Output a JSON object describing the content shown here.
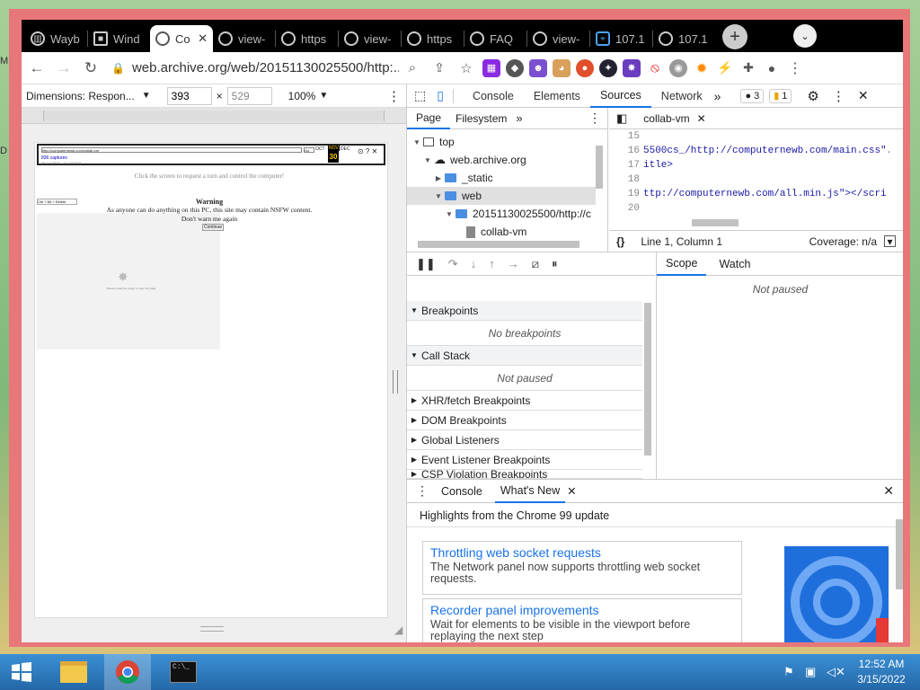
{
  "browser": {
    "tabs": [
      {
        "label": "Wayb",
        "icon": "archive-icon"
      },
      {
        "label": "Wind",
        "icon": "windows-icon"
      },
      {
        "label": "Co",
        "icon": "globe-icon",
        "active": true
      },
      {
        "label": "view-",
        "icon": "globe-icon"
      },
      {
        "label": "https",
        "icon": "globe-icon"
      },
      {
        "label": "view-",
        "icon": "globe-icon"
      },
      {
        "label": "https",
        "icon": "globe-icon"
      },
      {
        "label": "FAQ",
        "icon": "globe-icon"
      },
      {
        "label": "view-",
        "icon": "globe-icon"
      },
      {
        "label": "107.1",
        "icon": "location-icon"
      },
      {
        "label": "107.1",
        "icon": "globe-icon"
      }
    ],
    "new_tab": "+",
    "url": "web.archive.org/web/20151130025500/http:..."
  },
  "device_toolbar": {
    "dimensions_label": "Dimensions: Respon...",
    "width": "393",
    "times": "×",
    "height": "529",
    "zoom": "100%"
  },
  "page": {
    "url_field": "http://computernewb.com/collab-vm",
    "go": "Go",
    "link": "836 captures",
    "captures": "26 Jul 2015 - 10 Jul 2021",
    "cal_prev": "OCT",
    "cal_cur": "NOV",
    "cal_next": "DEC",
    "cal_day": "30",
    "click_msg": "Click the screen to request a turn and control the computer!",
    "ctrl_btn": "Ctrl + Alt + Delete",
    "warning_title": "Warning",
    "warning_text": "As anyone can do anything on this PC, this site may contain NSFW content.",
    "dont_warn": "Don't warn me again",
    "continue": "Continue",
    "plugin_msg": "Please install the plugin to view this page"
  },
  "devtools": {
    "top_tabs": [
      "Console",
      "Elements",
      "Sources",
      "Network"
    ],
    "selected_tab": "Sources",
    "errors": "3",
    "warnings": "1",
    "nav_tabs": [
      "Page",
      "Filesystem"
    ],
    "tree": [
      {
        "label": "top",
        "depth": 0,
        "kind": "frame"
      },
      {
        "label": "web.archive.org",
        "depth": 1,
        "kind": "cloud"
      },
      {
        "label": "_static",
        "depth": 2,
        "kind": "folder"
      },
      {
        "label": "web",
        "depth": 2,
        "kind": "folder"
      },
      {
        "label": "20151130025500/http://c",
        "depth": 3,
        "kind": "folder"
      },
      {
        "label": "collab-vm",
        "depth": 4,
        "kind": "file"
      }
    ],
    "editor_tab": "collab-vm",
    "code_lines": [
      {
        "n": "15",
        "t": ""
      },
      {
        "n": "16",
        "t": "5500cs_/http://computernewb.com/main.css\"."
      },
      {
        "n": "17",
        "t": "itle>"
      },
      {
        "n": "18",
        "t": ""
      },
      {
        "n": "19",
        "t": "ttp://computernewb.com/all.min.js\"></scri"
      },
      {
        "n": "20",
        "t": ""
      }
    ],
    "cursor_pos": "Line 1, Column 1",
    "coverage": "Coverage: n/a",
    "sections": {
      "breakpoints": "Breakpoints",
      "no_breakpoints": "No breakpoints",
      "call_stack": "Call Stack",
      "not_paused": "Not paused",
      "xhr": "XHR/fetch Breakpoints",
      "dom": "DOM Breakpoints",
      "global": "Global Listeners",
      "event": "Event Listener Breakpoints",
      "csp": "CSP Violation Breakpoints"
    },
    "scope_tabs": [
      "Scope",
      "Watch"
    ],
    "scope_msg": "Not paused",
    "drawer_tabs": [
      "Console",
      "What's New"
    ],
    "drawer_heading": "Highlights from the Chrome 99 update",
    "cards": [
      {
        "title": "Throttling web socket requests",
        "desc": "The Network panel now supports throttling web socket requests."
      },
      {
        "title": "Recorder panel improvements",
        "desc": "Wait for elements to be visible in the viewport before replaying the next step"
      }
    ]
  },
  "taskbar": {
    "time": "12:52 AM",
    "date": "3/15/2022"
  },
  "colors": {
    "accent": "#1a73e8",
    "window_border": "#e8777a",
    "taskbar": "#2a7bc0"
  }
}
